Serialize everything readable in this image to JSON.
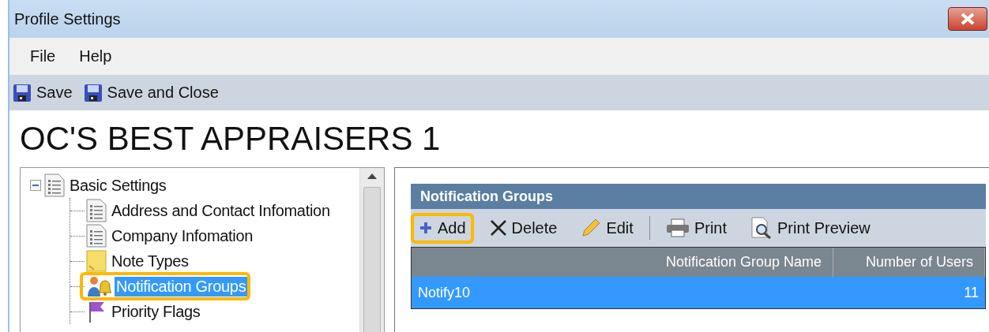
{
  "window": {
    "title": "Profile Settings"
  },
  "menu": [
    {
      "label": "File"
    },
    {
      "label": "Help"
    }
  ],
  "toolbar": [
    {
      "label": "Save",
      "kind": "save"
    },
    {
      "label": "Save and Close",
      "kind": "save"
    }
  ],
  "heading": "OC'S BEST APPRAISERS 1",
  "tree": [
    {
      "label": "Basic Settings",
      "kind": "page",
      "expanded": true,
      "selected": false,
      "children": [
        {
          "label": "Address and Contact Infomation",
          "kind": "page",
          "selected": false,
          "highlighted": false
        },
        {
          "label": "Company Infomation",
          "kind": "page",
          "selected": false,
          "highlighted": false
        },
        {
          "label": "Note Types",
          "kind": "note",
          "selected": false,
          "highlighted": false
        },
        {
          "label": "Notification Groups",
          "kind": "bell",
          "selected": true,
          "highlighted": true
        },
        {
          "label": "Priority Flags",
          "kind": "flag",
          "selected": false,
          "highlighted": false
        }
      ]
    }
  ],
  "panel": {
    "title": "Notification Groups",
    "actions": [
      {
        "label": "Add",
        "kind": "add",
        "highlighted": true
      },
      {
        "label": "Delete",
        "kind": "delete",
        "highlighted": false
      },
      {
        "label": "Edit",
        "kind": "edit",
        "highlighted": false
      },
      {
        "label": "Print",
        "kind": "print",
        "highlighted": false
      },
      {
        "label": "Print Preview",
        "kind": "preview",
        "highlighted": false
      }
    ],
    "table": {
      "columns": [
        "Notification Group Name",
        "Number of Users"
      ],
      "rows": [
        {
          "cells": [
            "Notify10",
            "11"
          ],
          "selected": true
        }
      ]
    }
  }
}
